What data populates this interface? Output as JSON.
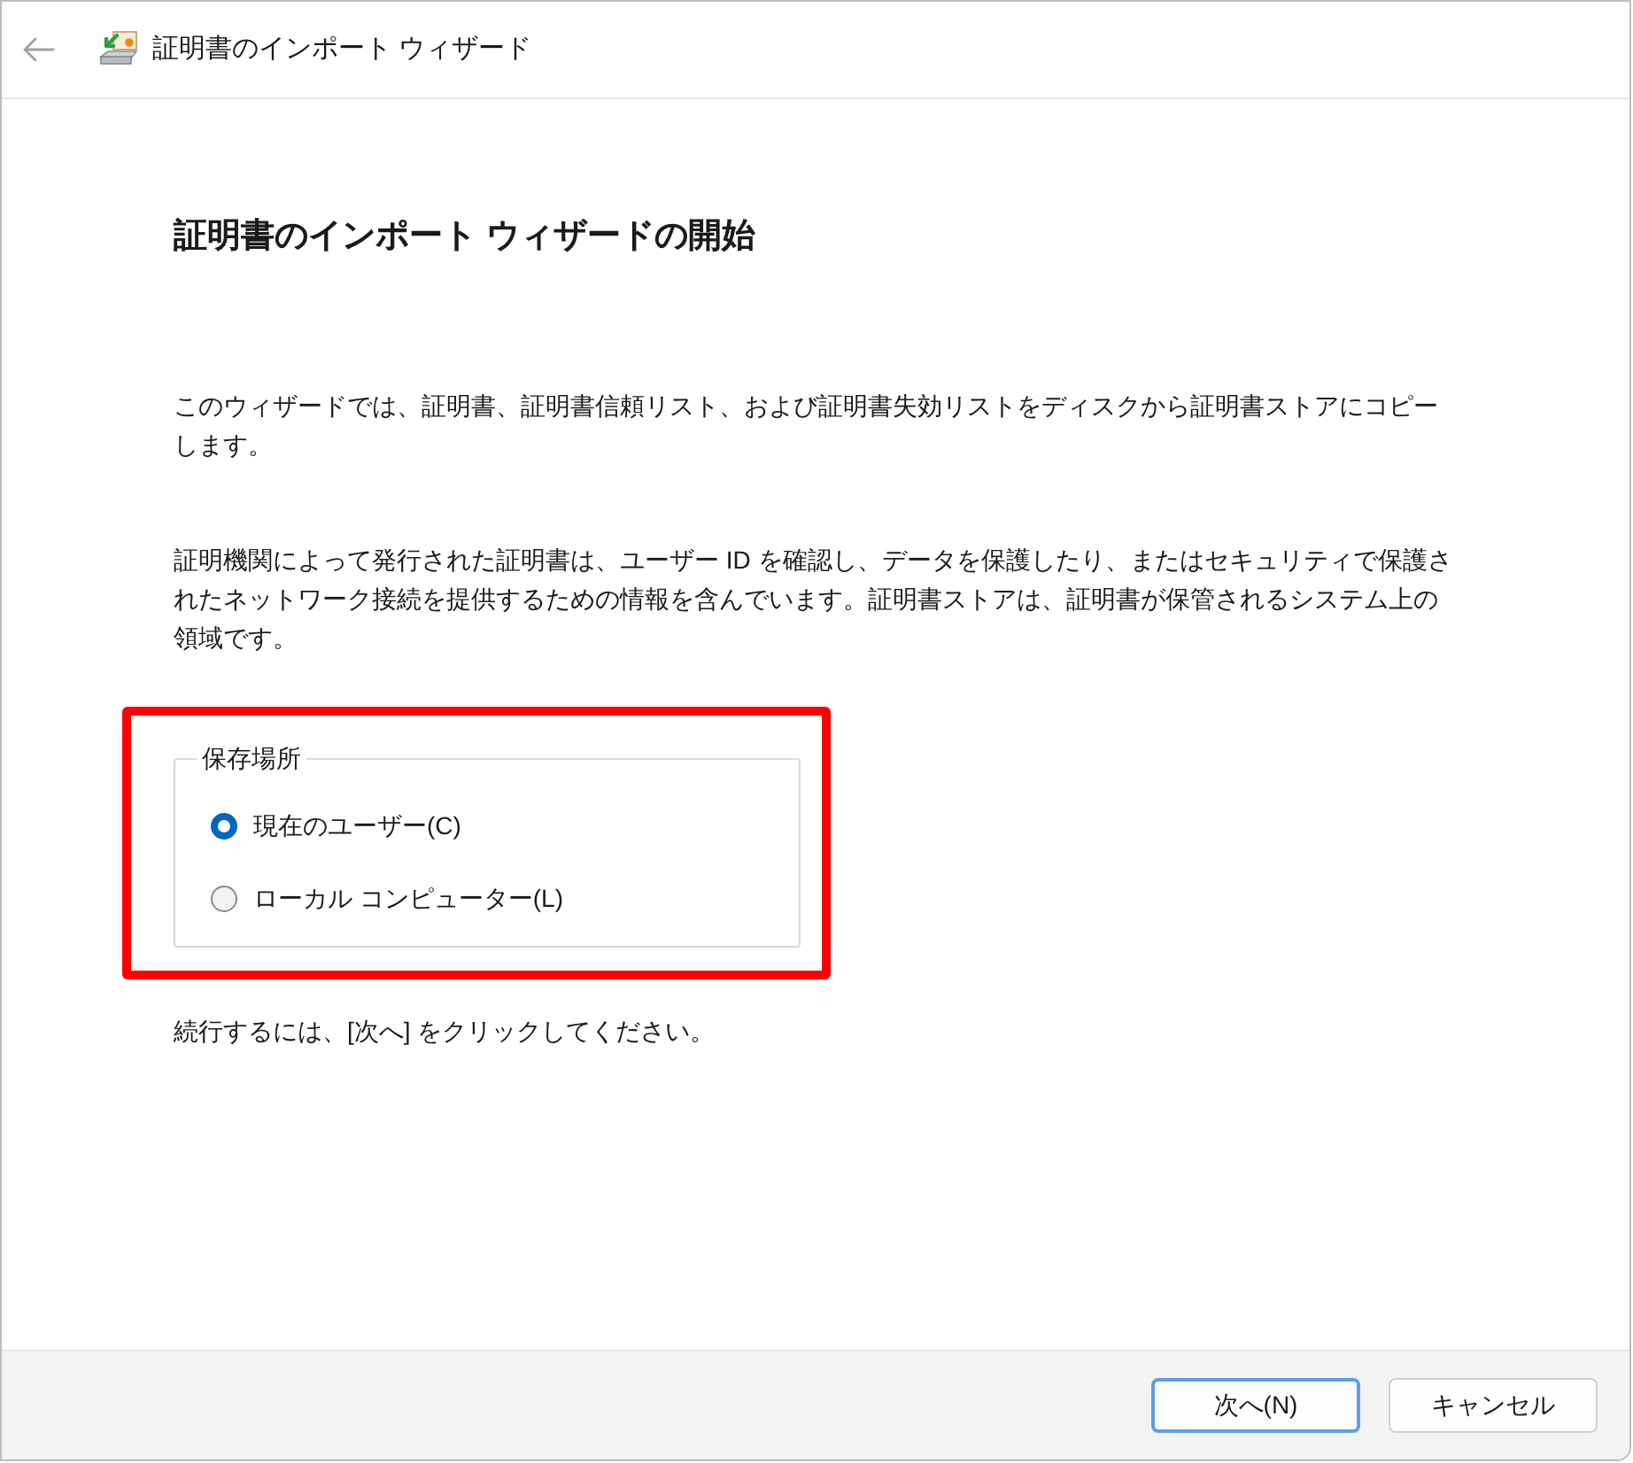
{
  "window": {
    "title": "証明書のインポート ウィザード",
    "back_button": {
      "disabled": true
    }
  },
  "heading": "証明書のインポート ウィザードの開始",
  "paragraphs": [
    "このウィザードでは、証明書、証明書信頼リスト、および証明書失効リストをディスクから証明書ストアにコピーします。",
    "証明機関によって発行された証明書は、ユーザー ID を確認し、データを保護したり、またはセキュリティで保護されたネットワーク接続を提供するための情報を含んでいます。証明書ストアは、証明書が保管されるシステム上の領域です。"
  ],
  "store_location": {
    "legend": "保存場所",
    "highlighted": true,
    "options": [
      {
        "label": "現在のユーザー(C)",
        "selected": true
      },
      {
        "label": "ローカル コンピューター(L)",
        "selected": false
      }
    ]
  },
  "instruction": "続行するには、[次へ] をクリックしてください。",
  "buttons": [
    {
      "label": "次へ(N)",
      "default": true
    },
    {
      "label": "キャンセル",
      "default": false
    }
  ]
}
